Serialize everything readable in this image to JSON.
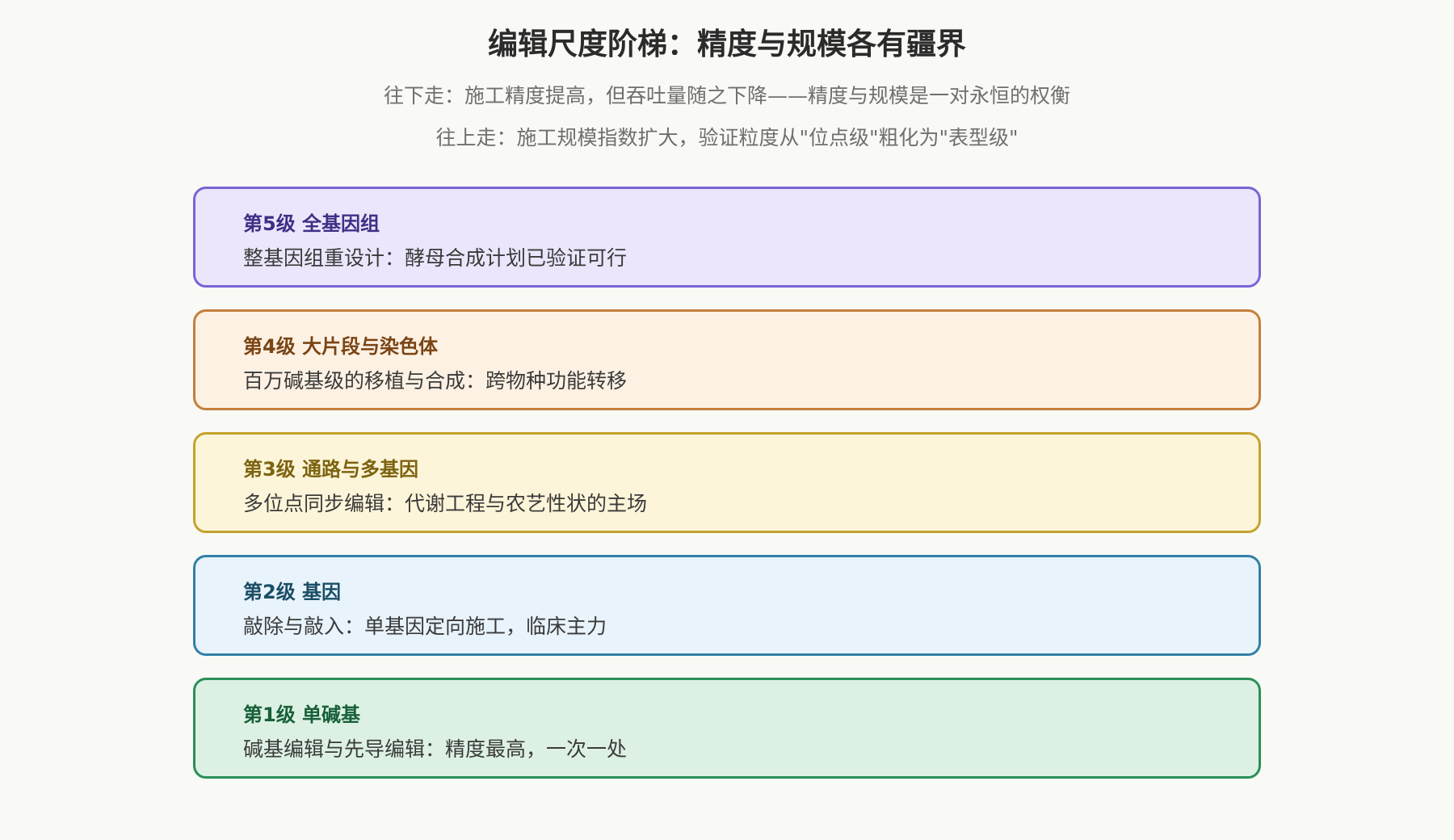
{
  "header": {
    "title": "编辑尺度阶梯：精度与规模各有疆界",
    "subtitle_down": "往下走：施工精度提高，但吞吐量随之下降——精度与规模是一对永恒的权衡",
    "subtitle_up": "往上走：施工规模指数扩大，验证粒度从\"位点级\"粗化为\"表型级\""
  },
  "levels": [
    {
      "name": "第5级 全基因组",
      "desc": "整基因组重设计：酵母合成计划已验证可行",
      "accent": "#7b63d6"
    },
    {
      "name": "第4级 大片段与染色体",
      "desc": "百万碱基级的移植与合成：跨物种功能转移",
      "accent": "#c47f3c"
    },
    {
      "name": "第3级 通路与多基因",
      "desc": "多位点同步编辑：代谢工程与农艺性状的主场",
      "accent": "#c4a22e"
    },
    {
      "name": "第2级 基因",
      "desc": "敲除与敲入：单基因定向施工，临床主力",
      "accent": "#3380a6"
    },
    {
      "name": "第1级 单碱基",
      "desc": "碱基编辑与先导编辑：精度最高，一次一处",
      "accent": "#2b8f58"
    }
  ]
}
